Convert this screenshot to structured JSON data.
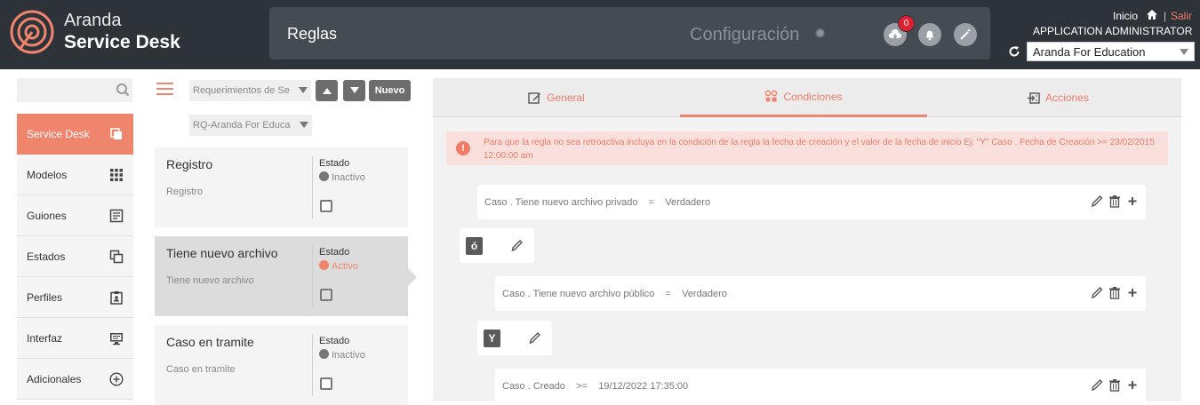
{
  "header": {
    "brand_line1": "Aranda",
    "brand_line2": "Service Desk",
    "module_title": "Reglas",
    "config_label": "Configuración",
    "notification_count": "0",
    "home_label": "Inicio",
    "separator": "|",
    "logout_label": "Salir",
    "user_role": "APPLICATION ADMINISTRATOR",
    "project_select": "Aranda For Education"
  },
  "sidebar": {
    "items": [
      {
        "label": "Service Desk",
        "icon": "copy-icon"
      },
      {
        "label": "Modelos",
        "icon": "grid-icon"
      },
      {
        "label": "Guiones",
        "icon": "document-icon"
      },
      {
        "label": "Estados",
        "icon": "copy-icon"
      },
      {
        "label": "Perfiles",
        "icon": "clipboard-icon"
      },
      {
        "label": "Interfaz",
        "icon": "monitor-icon"
      },
      {
        "label": "Adicionales",
        "icon": "plus-circle-icon"
      }
    ]
  },
  "filters": {
    "category": "Requerimientos de Se",
    "project": "RQ-Aranda For Educa",
    "new_label": "Nuevo"
  },
  "rules": [
    {
      "title": "Registro",
      "subtitle": "Registro",
      "estado_label": "Estado",
      "status": "Inactivo"
    },
    {
      "title": "Tiene nuevo archivo",
      "subtitle": "Tiene nuevo archivo",
      "estado_label": "Estado",
      "status": "Activo"
    },
    {
      "title": "Caso en tramite",
      "subtitle": "Caso en tramite",
      "estado_label": "Estado",
      "status": "Inactivo"
    }
  ],
  "tabs": [
    {
      "label": "General"
    },
    {
      "label": "Condiciones"
    },
    {
      "label": "Acciones"
    }
  ],
  "alert": {
    "icon": "!",
    "text": "Para que la regla no sea retroactiva incluya en la condición de la regla la fecha de creación y el valor de la fecha de inicio Ej: \"Y\" Caso . Fecha de Creación >= 23/02/2015 12:00:00 am"
  },
  "conditions": [
    {
      "text": "Caso . Tiene nuevo archivo privado    =    Verdadero"
    },
    {
      "operator": "ó"
    },
    {
      "text": "Caso . Tiene nuevo archivo público    =    Verdadero"
    },
    {
      "operator": "Y"
    },
    {
      "text": "Caso . Creado    >=    19/12/2022 17:35:00"
    }
  ],
  "colors": {
    "accent": "#f0856e",
    "topbar": "#2e333a",
    "alert_bg": "#fae0dc"
  }
}
